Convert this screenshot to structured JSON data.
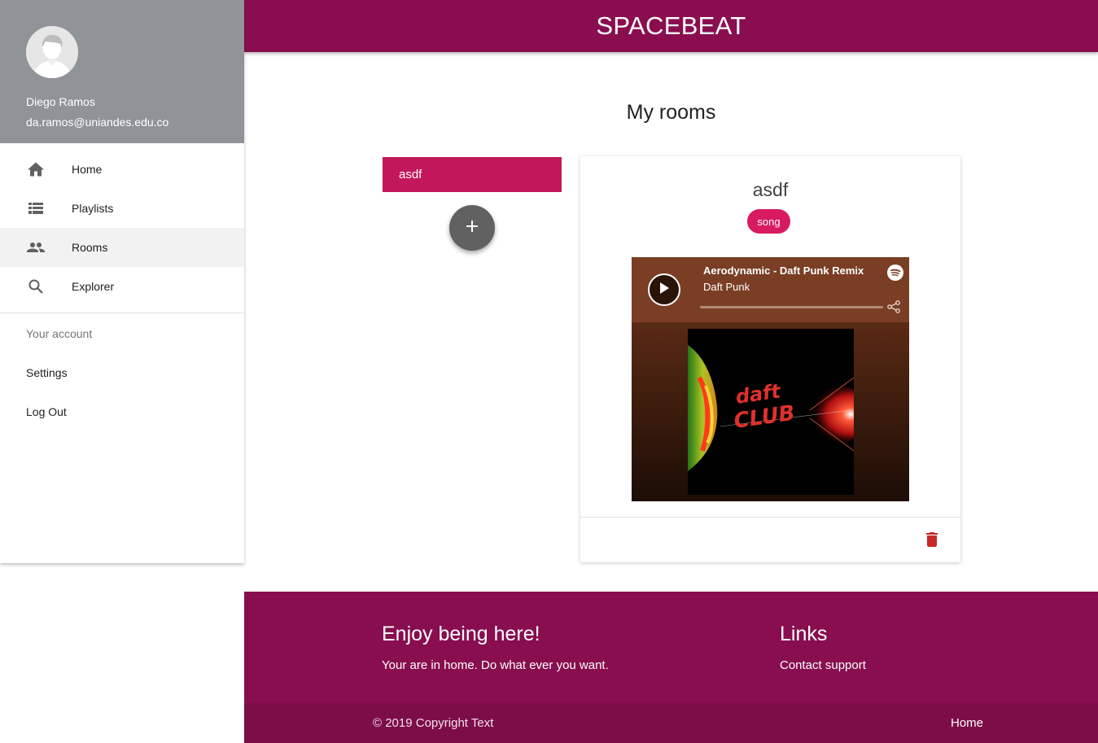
{
  "app": {
    "title": "SPACEBEAT",
    "header_color": "#8a0e4f"
  },
  "user": {
    "name": "Diego Ramos",
    "email": "da.ramos@uniandes.edu.co",
    "avatar_icon": "user-avatar-icon"
  },
  "nav": {
    "items": [
      {
        "label": "Home",
        "icon": "home-icon",
        "active": false
      },
      {
        "label": "Playlists",
        "icon": "list-icon",
        "active": false
      },
      {
        "label": "Rooms",
        "icon": "people-icon",
        "active": true
      },
      {
        "label": "Explorer",
        "icon": "search-icon",
        "active": false
      }
    ],
    "account_header": "Your account",
    "account_items": [
      {
        "label": "Settings"
      },
      {
        "label": "Log Out"
      }
    ]
  },
  "main": {
    "page_title": "My rooms",
    "rooms": [
      {
        "name": "asdf"
      }
    ],
    "add_button_icon": "plus-icon",
    "selected_room": {
      "name": "asdf",
      "type_chip": "song",
      "player": {
        "track_title": "Aerodynamic - Daft Punk Remix",
        "artist": "Daft Punk",
        "progress": 0,
        "cover_text": "daft club"
      }
    }
  },
  "footer": {
    "left_heading": "Enjoy being here!",
    "left_text": "Your are in home. Do what ever you want.",
    "right_heading": "Links",
    "right_link": "Contact support",
    "copyright": "© 2019 Copyright Text",
    "bottom_link": "Home"
  }
}
